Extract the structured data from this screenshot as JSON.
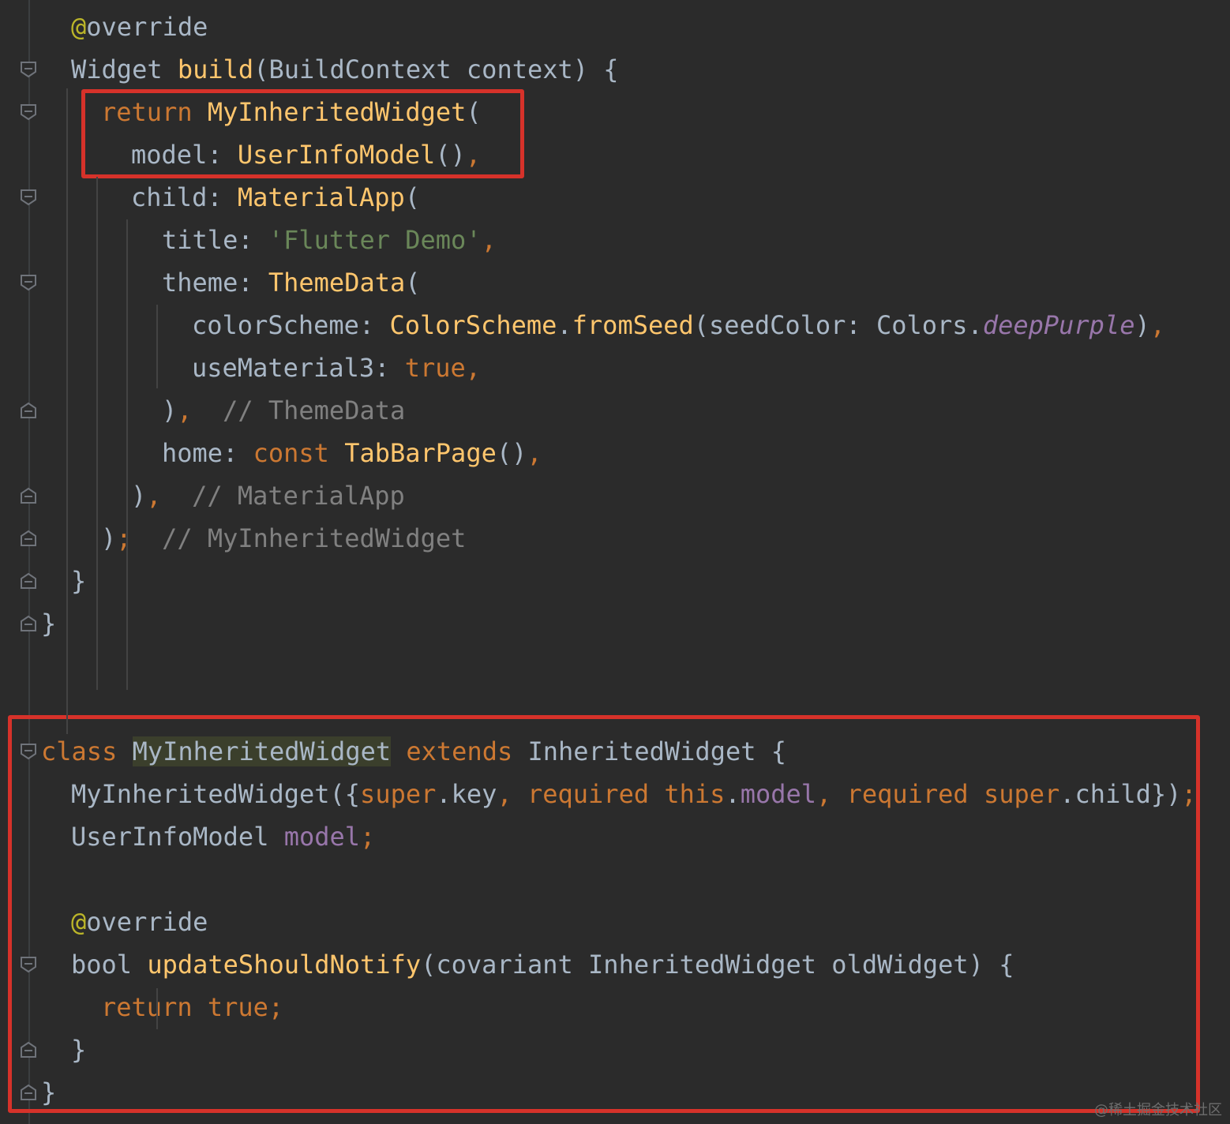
{
  "editor": {
    "lines": [
      [
        {
          "t": "@",
          "c": "ann"
        },
        {
          "t": "override",
          "c": "plain"
        }
      ],
      [
        {
          "t": "Widget ",
          "c": "plain"
        },
        {
          "t": "build",
          "c": "fn"
        },
        {
          "t": "(BuildContext context) {",
          "c": "plain"
        }
      ],
      [
        {
          "t": "return ",
          "c": "kw"
        },
        {
          "t": "MyInheritedWidget",
          "c": "fn"
        },
        {
          "t": "(",
          "c": "plain"
        }
      ],
      [
        {
          "t": "model: ",
          "c": "plain"
        },
        {
          "t": "UserInfoModel",
          "c": "fn"
        },
        {
          "t": "()",
          "c": "plain"
        },
        {
          "t": ",",
          "c": "kw"
        }
      ],
      [
        {
          "t": "child: ",
          "c": "plain"
        },
        {
          "t": "MaterialApp",
          "c": "fn"
        },
        {
          "t": "(",
          "c": "plain"
        }
      ],
      [
        {
          "t": "title: ",
          "c": "plain"
        },
        {
          "t": "'Flutter Demo'",
          "c": "str"
        },
        {
          "t": ",",
          "c": "kw"
        }
      ],
      [
        {
          "t": "theme: ",
          "c": "plain"
        },
        {
          "t": "ThemeData",
          "c": "fn"
        },
        {
          "t": "(",
          "c": "plain"
        }
      ],
      [
        {
          "t": "colorScheme: ",
          "c": "plain"
        },
        {
          "t": "ColorScheme",
          "c": "fn"
        },
        {
          "t": ".",
          "c": "plain"
        },
        {
          "t": "fromSeed",
          "c": "fn"
        },
        {
          "t": "(seedColor: Colors.",
          "c": "plain"
        },
        {
          "t": "deepPurple",
          "c": "field-i"
        },
        {
          "t": ")",
          "c": "plain"
        },
        {
          "t": ",",
          "c": "kw"
        }
      ],
      [
        {
          "t": "useMaterial3: ",
          "c": "plain"
        },
        {
          "t": "true",
          "c": "kw"
        },
        {
          "t": ",",
          "c": "kw"
        }
      ],
      [
        {
          "t": ")",
          "c": "plain"
        },
        {
          "t": ",",
          "c": "kw"
        },
        {
          "t": "  // ThemeData",
          "c": "com"
        }
      ],
      [
        {
          "t": "home: ",
          "c": "plain"
        },
        {
          "t": "const ",
          "c": "kw"
        },
        {
          "t": "TabBarPage",
          "c": "fn"
        },
        {
          "t": "()",
          "c": "plain"
        },
        {
          "t": ",",
          "c": "kw"
        }
      ],
      [
        {
          "t": ")",
          "c": "plain"
        },
        {
          "t": ",",
          "c": "kw"
        },
        {
          "t": "  // MaterialApp",
          "c": "com"
        }
      ],
      [
        {
          "t": ")",
          "c": "plain"
        },
        {
          "t": ";",
          "c": "kw"
        },
        {
          "t": "  // MyInheritedWidget",
          "c": "com"
        }
      ],
      [
        {
          "t": "}",
          "c": "plain"
        }
      ],
      [
        {
          "t": "}",
          "c": "plain"
        }
      ],
      [],
      [],
      [
        {
          "t": "class ",
          "c": "kw"
        },
        {
          "t": "MyInheritedWidget",
          "c": "hl"
        },
        {
          "t": " ",
          "c": "plain"
        },
        {
          "t": "extends ",
          "c": "kw"
        },
        {
          "t": "InheritedWidget {",
          "c": "plain"
        }
      ],
      [
        {
          "t": "MyInheritedWidget({",
          "c": "plain"
        },
        {
          "t": "super",
          "c": "kw"
        },
        {
          "t": ".key",
          "c": "plain"
        },
        {
          "t": ", ",
          "c": "kw"
        },
        {
          "t": "required ",
          "c": "kw"
        },
        {
          "t": "this",
          "c": "kw"
        },
        {
          "t": ".",
          "c": "plain"
        },
        {
          "t": "model",
          "c": "field"
        },
        {
          "t": ", ",
          "c": "kw"
        },
        {
          "t": "required ",
          "c": "kw"
        },
        {
          "t": "super",
          "c": "kw"
        },
        {
          "t": ".child})",
          "c": "plain"
        },
        {
          "t": ";",
          "c": "kw"
        }
      ],
      [
        {
          "t": "UserInfoModel ",
          "c": "plain"
        },
        {
          "t": "model",
          "c": "field"
        },
        {
          "t": ";",
          "c": "kw"
        }
      ],
      [],
      [
        {
          "t": "@",
          "c": "ann"
        },
        {
          "t": "override",
          "c": "plain"
        }
      ],
      [
        {
          "t": "bool ",
          "c": "plain"
        },
        {
          "t": "updateShouldNotify",
          "c": "fn"
        },
        {
          "t": "(covariant InheritedWidget oldWidget) {",
          "c": "plain"
        }
      ],
      [
        {
          "t": "return ",
          "c": "kw"
        },
        {
          "t": "true",
          "c": "kw"
        },
        {
          "t": ";",
          "c": "kw"
        }
      ],
      [
        {
          "t": "}",
          "c": "plain"
        }
      ],
      [
        {
          "t": "}",
          "c": "plain"
        }
      ]
    ]
  },
  "watermark": "@稀土掘金技术社区"
}
